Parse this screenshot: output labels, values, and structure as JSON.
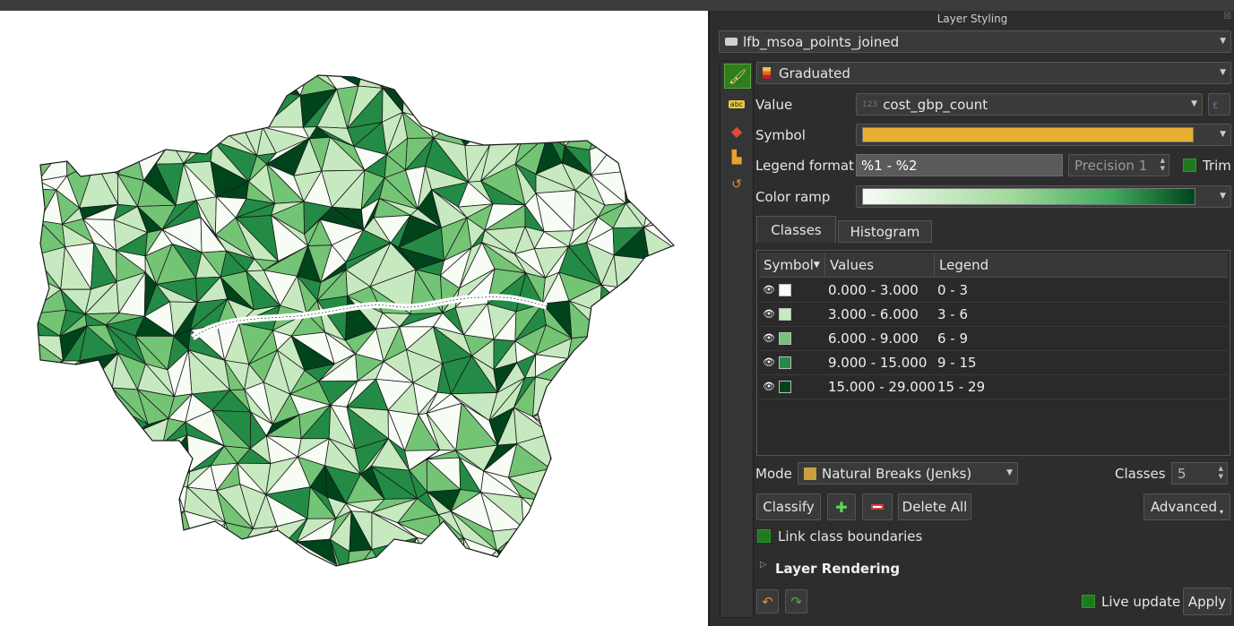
{
  "panel": {
    "title": "Layer Styling"
  },
  "layer": {
    "name": "lfb_msoa_points_joined",
    "icon": "polygon-layer-icon"
  },
  "renderer": {
    "type": "Graduated",
    "icon": "graduated-renderer-icon"
  },
  "value": {
    "label": "Value",
    "field": "cost_gbp_count"
  },
  "symbol": {
    "label": "Symbol",
    "color": "#e8b030"
  },
  "legend_format": {
    "label": "Legend format",
    "value": "%1 - %2",
    "precision": "Precision 1",
    "trim": "Trim"
  },
  "color_ramp": {
    "label": "Color ramp",
    "start": "#f7fcf5",
    "end": "#00441b"
  },
  "tabs": [
    "Classes",
    "Histogram"
  ],
  "table": {
    "headers": [
      "Symbol",
      "Values",
      "Legend"
    ],
    "rows": [
      {
        "color": "#f7fcf5",
        "values": "0.000 - 3.000",
        "legend": "0 - 3"
      },
      {
        "color": "#c7e9c0",
        "values": "3.000 - 6.000",
        "legend": "3 - 6"
      },
      {
        "color": "#74c476",
        "values": "6.000 - 9.000",
        "legend": "6 - 9"
      },
      {
        "color": "#238b45",
        "values": "9.000 - 15.000",
        "legend": "9 - 15"
      },
      {
        "color": "#00441b",
        "values": "15.000 - 29.000",
        "legend": "15 - 29"
      }
    ]
  },
  "mode": {
    "label": "Mode",
    "value": "Natural Breaks (Jenks)",
    "classes_label": "Classes",
    "classes": "5"
  },
  "buttons": {
    "classify": "Classify",
    "delete_all": "Delete All",
    "advanced": "Advanced",
    "apply": "Apply"
  },
  "link_class_boundaries": "Link class boundaries",
  "layer_rendering": "Layer Rendering",
  "live_update": "Live update"
}
